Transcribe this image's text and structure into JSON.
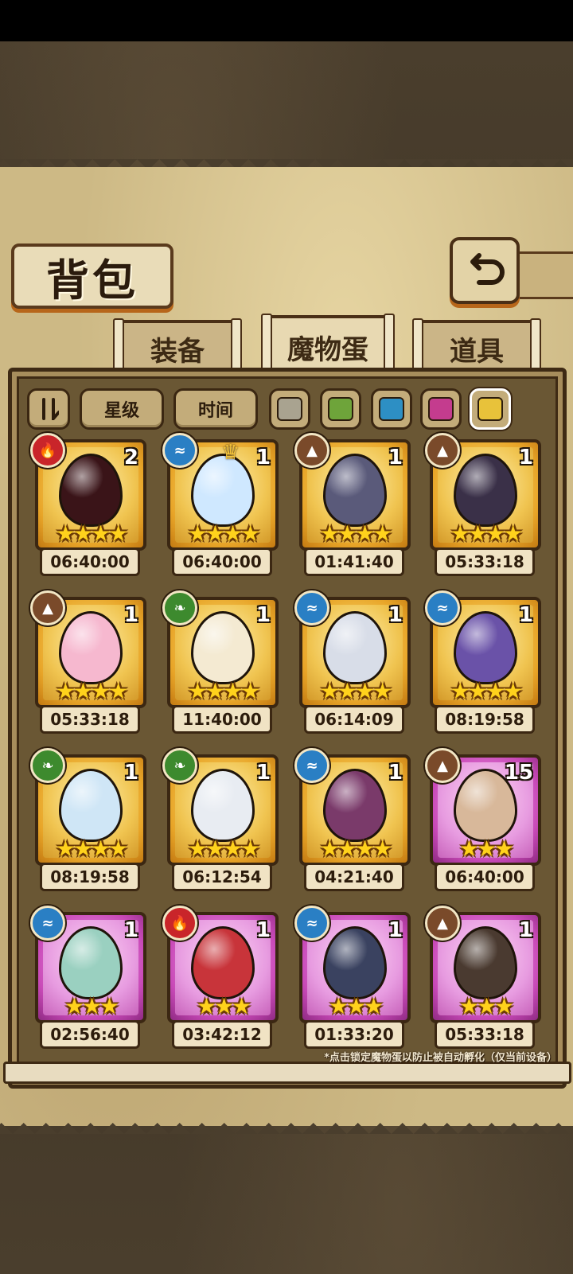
{
  "header": {
    "title": "背包"
  },
  "tabs": [
    {
      "label": "装备",
      "active": false
    },
    {
      "label": "魔物蛋",
      "active": true
    },
    {
      "label": "道具",
      "active": false
    }
  ],
  "filters": {
    "sort_icon": "sort-icon",
    "star_label": "星级",
    "time_label": "时间",
    "colors": [
      "#a9a390",
      "#6ea43a",
      "#2d8fc4",
      "#c43c8e",
      "#e8c23a"
    ]
  },
  "eggs": [
    {
      "element": "fire",
      "count": "2",
      "stars": 4,
      "rarity": "gold",
      "timer": "06:40:00",
      "egg_color": "#3a1418"
    },
    {
      "element": "water",
      "count": "1",
      "stars": 4,
      "rarity": "gold",
      "timer": "06:40:00",
      "egg_color": "#cfe8ff",
      "crown": true
    },
    {
      "element": "earth",
      "count": "1",
      "stars": 4,
      "rarity": "gold",
      "timer": "01:41:40",
      "egg_color": "#5a5a7a"
    },
    {
      "element": "earth",
      "count": "1",
      "stars": 4,
      "rarity": "gold",
      "timer": "05:33:18",
      "egg_color": "#3a3048"
    },
    {
      "element": "earth",
      "count": "1",
      "stars": 4,
      "rarity": "gold",
      "timer": "05:33:18",
      "egg_color": "#f6b8cf"
    },
    {
      "element": "grass",
      "count": "1",
      "stars": 4,
      "rarity": "gold",
      "timer": "11:40:00",
      "egg_color": "#f4ead2"
    },
    {
      "element": "water",
      "count": "1",
      "stars": 4,
      "rarity": "gold",
      "timer": "06:14:09",
      "egg_color": "#d8dde8"
    },
    {
      "element": "water",
      "count": "1",
      "stars": 4,
      "rarity": "gold",
      "timer": "08:19:58",
      "egg_color": "#6a52a8"
    },
    {
      "element": "grass",
      "count": "1",
      "stars": 4,
      "rarity": "gold",
      "timer": "08:19:58",
      "egg_color": "#cfe6f6"
    },
    {
      "element": "grass",
      "count": "1",
      "stars": 4,
      "rarity": "gold",
      "timer": "06:12:54",
      "egg_color": "#e8ecf2"
    },
    {
      "element": "water",
      "count": "1",
      "stars": 4,
      "rarity": "gold",
      "timer": "04:21:40",
      "egg_color": "#7a3a6a"
    },
    {
      "element": "earth",
      "count": "15",
      "stars": 3,
      "rarity": "purple",
      "timer": "06:40:00",
      "egg_color": "#d8b89a"
    },
    {
      "element": "water",
      "count": "1",
      "stars": 3,
      "rarity": "purple",
      "timer": "02:56:40",
      "egg_color": "#9ad0c0"
    },
    {
      "element": "fire",
      "count": "1",
      "stars": 3,
      "rarity": "purple",
      "timer": "03:42:12",
      "egg_color": "#c8343a"
    },
    {
      "element": "water",
      "count": "1",
      "stars": 3,
      "rarity": "purple",
      "timer": "01:33:20",
      "egg_color": "#3a4260"
    },
    {
      "element": "earth",
      "count": "1",
      "stars": 3,
      "rarity": "purple",
      "timer": "05:33:18",
      "egg_color": "#4a3a30"
    }
  ],
  "footnote": "*点击锁定魔物蛋以防止被自动孵化（仅当前设备）",
  "icons": {
    "fire": "fire-icon",
    "water": "water-icon",
    "earth": "mountain-icon",
    "grass": "leaf-icon",
    "back": "back-arrow-icon",
    "crown": "crown-icon"
  }
}
